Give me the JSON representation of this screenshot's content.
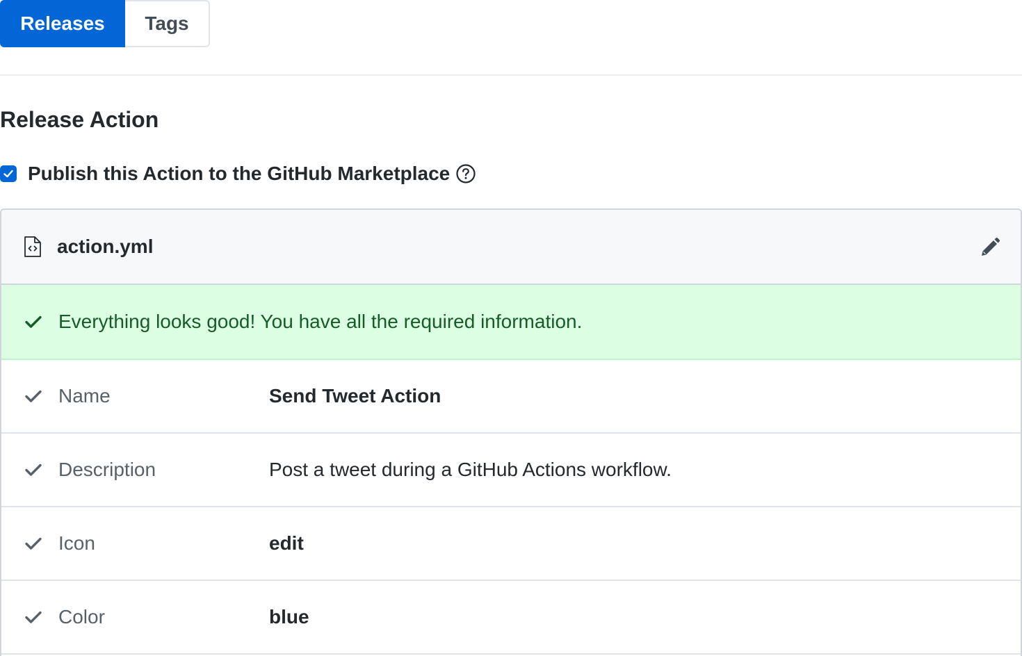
{
  "tabs": {
    "releases": "Releases",
    "tags": "Tags"
  },
  "section_title": "Release Action",
  "publish": {
    "label": "Publish this Action to the GitHub Marketplace",
    "checked": true
  },
  "file": {
    "name": "action.yml"
  },
  "success_message": "Everything looks good! You have all the required information.",
  "fields": [
    {
      "label": "Name",
      "value": "Send Tweet Action"
    },
    {
      "label": "Description",
      "value": "Post a tweet during a GitHub Actions workflow."
    },
    {
      "label": "Icon",
      "value": "edit"
    },
    {
      "label": "Color",
      "value": "blue"
    }
  ],
  "colors": {
    "accent": "#0366d6",
    "success_bg": "#dcffe4",
    "success_text": "#165c26"
  },
  "icons": {
    "file": "file-code-icon",
    "edit": "pencil-icon",
    "help": "question-icon",
    "check": "check-icon"
  }
}
